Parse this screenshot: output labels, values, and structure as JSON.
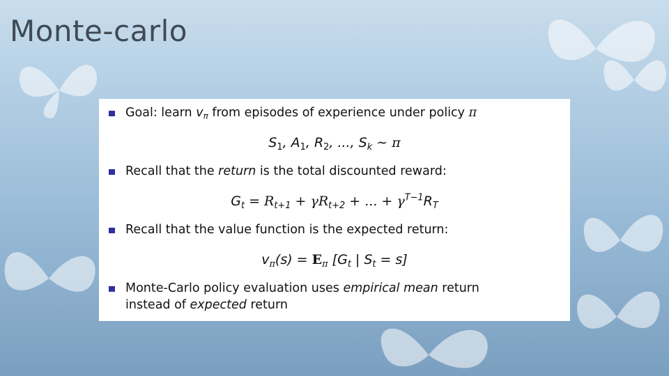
{
  "slide": {
    "title": "Monte-carlo"
  },
  "content": {
    "bullet1": {
      "prefix": "Goal:  learn ",
      "var_v": "v",
      "var_v_sub": "π",
      "suffix": " from episodes of experience under policy ",
      "pi": "π"
    },
    "formula1": {
      "text": "S1, A1, R2, ..., Sk ∼ π",
      "parts": [
        "S",
        "1",
        ", A",
        "1",
        ", R",
        "2",
        ", ..., S",
        "k",
        " ∼ π"
      ]
    },
    "bullet2": {
      "prefix": "Recall that the ",
      "emph": "return",
      "suffix": " is the total discounted reward:"
    },
    "formula2": {
      "text": "Gt = Rt+1 + γRt+2 + ... + γ^(T−1) RT",
      "parts": [
        "G",
        "t",
        " = R",
        "t+1",
        " + γR",
        "t+2",
        " + ... + γ",
        "T−1",
        "R",
        "T"
      ]
    },
    "bullet3": {
      "text": "Recall that the value function is the expected return:"
    },
    "formula3": {
      "text": "vπ(s) = Eπ [Gt | St = s]",
      "parts": [
        "v",
        "π",
        "(s) = ",
        "E",
        "π",
        " [G",
        "t",
        " | S",
        "t",
        " = s]"
      ]
    },
    "bullet4": {
      "line1_prefix": "Monte-Carlo policy evaluation uses ",
      "line1_emph": "empirical mean",
      "line1_suffix": " return",
      "line2_prefix": "instead of ",
      "line2_emph": "expected",
      "line2_suffix": " return"
    }
  },
  "colors": {
    "bullet": "#2f2f9f",
    "title": "#3f4a55",
    "background_top": "#c9ddec",
    "background_bottom": "#7b9fbf"
  }
}
